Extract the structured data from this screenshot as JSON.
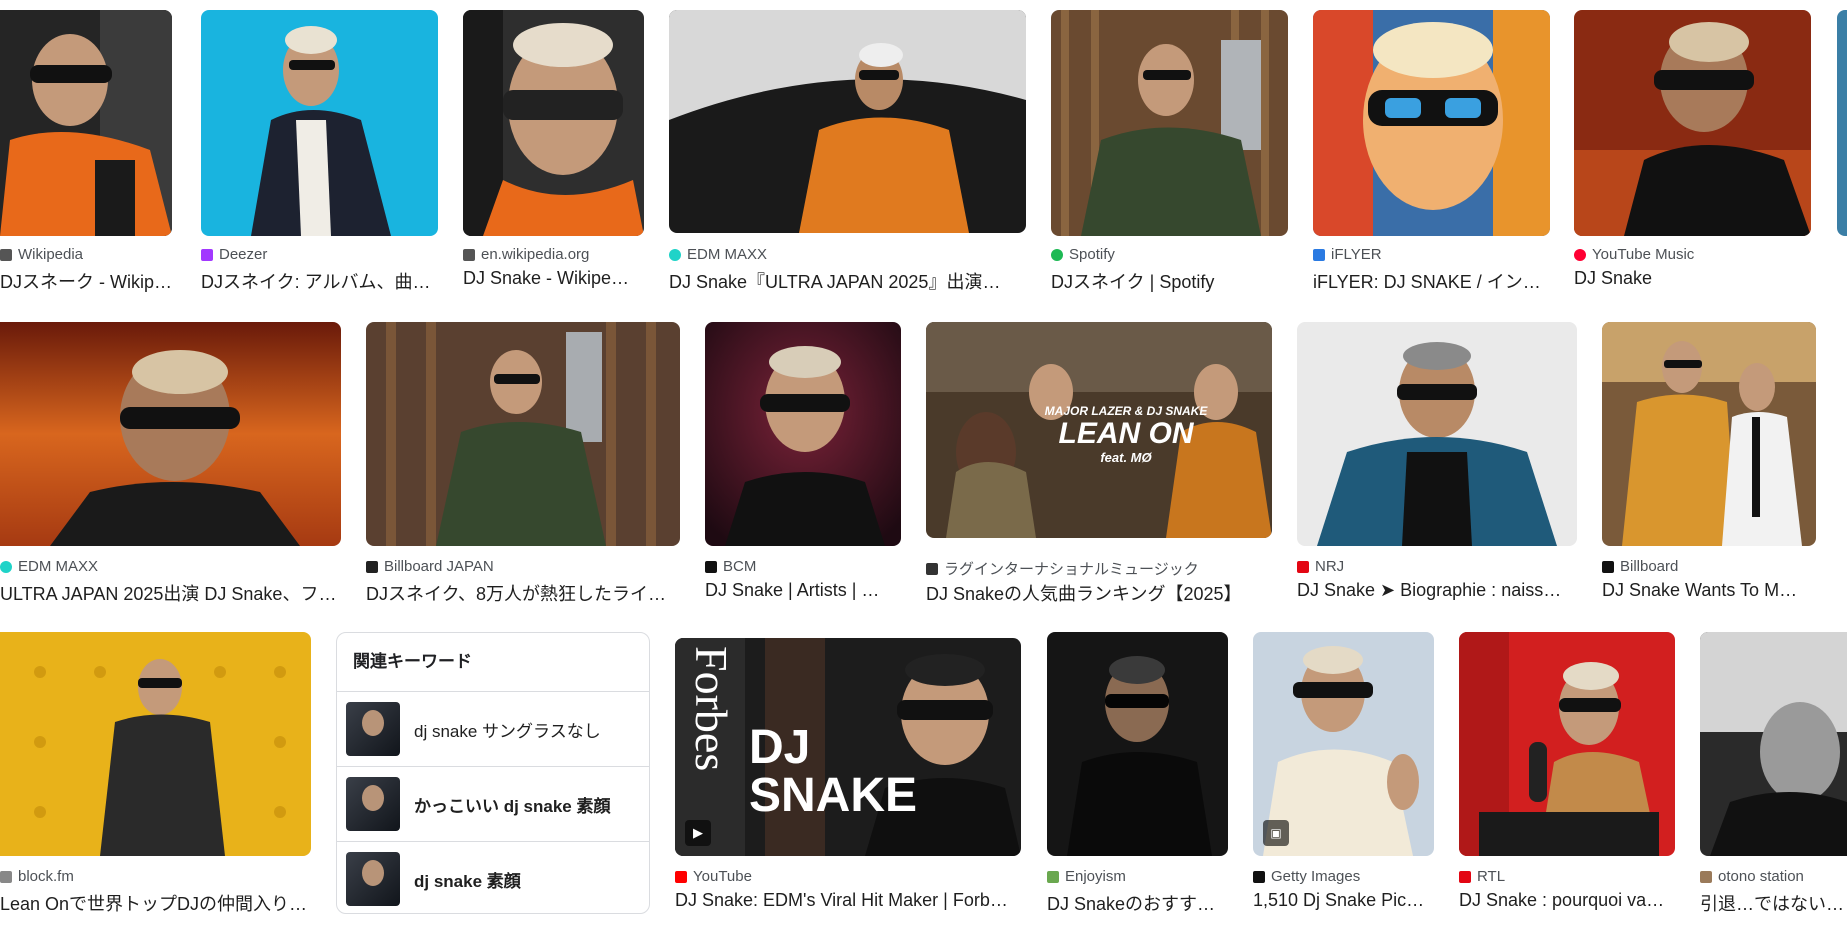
{
  "related": {
    "heading": "関連キーワード",
    "items": [
      {
        "label": "dj snake サングラスなし"
      },
      {
        "label": "かっこいい dj snake 素顔"
      },
      {
        "label": "dj snake 素顔"
      }
    ]
  },
  "results": [
    {
      "source": "Wikipedia",
      "title": "DJスネーク - Wikip…",
      "favicon_color": "#555555",
      "bg": "#2b2b2b"
    },
    {
      "source": "Deezer",
      "title": "DJスネイク: アルバム、曲…",
      "favicon_color": "#a238ff",
      "bg": "#19b4df"
    },
    {
      "source": "en.wikipedia.org",
      "title": "DJ Snake - Wikipe…",
      "favicon_color": "#555555",
      "bg": "#3a3a3a"
    },
    {
      "source": "EDM MAXX",
      "title": "DJ Snake『ULTRA JAPAN 2025』出演…",
      "favicon_color": "#1fd3c8",
      "bg": "#1a1a1a"
    },
    {
      "source": "Spotify",
      "title": "DJスネイク | Spotify",
      "favicon_color": "#1db954",
      "bg": "#6a4a30"
    },
    {
      "source": "iFLYER",
      "title": "iFLYER: DJ SNAKE / イン…",
      "favicon_color": "#2a7ae2",
      "bg": "#d97a2a"
    },
    {
      "source": "YouTube Music",
      "title": "DJ Snake",
      "favicon_color": "#ff0033",
      "bg": "#8a2a12"
    },
    {
      "source": "EDM MAXX",
      "title": "ULTRA JAPAN 2025出演 DJ Snake、フ…",
      "favicon_color": "#1fd3c8",
      "bg": "#b2461a"
    },
    {
      "source": "Billboard JAPAN",
      "title": "DJスネイク、8万人が熱狂したライ…",
      "favicon_color": "#222222",
      "bg": "#5a4030"
    },
    {
      "source": "BCM",
      "title": "DJ Snake | Artists | …",
      "favicon_color": "#111111",
      "bg": "#3a0e1e"
    },
    {
      "source": "ラグインターナショナルミュージック",
      "title": "DJ Snakeの人気曲ランキング【2025】",
      "favicon_color": "#333333",
      "bg": "#5a4430"
    },
    {
      "source": "NRJ",
      "title": "DJ Snake ➤ Biographie : naiss…",
      "favicon_color": "#e30613",
      "bg": "#eaeaea"
    },
    {
      "source": "Billboard",
      "title": "DJ Snake Wants To M…",
      "favicon_color": "#111111",
      "bg": "#7a5a3a"
    },
    {
      "source": "block.fm",
      "title": "Lean Onで世界トップDJの仲間入り…",
      "favicon_color": "#888888",
      "bg": "#e8b21a"
    },
    {
      "source": "YouTube",
      "title": "DJ Snake: EDM's Viral Hit Maker | Forb…",
      "favicon_color": "#ff0000",
      "bg": "#1c1c1c",
      "overlay": {
        "brand": "Forbes",
        "line1": "DJ",
        "line2": "SNAKE"
      }
    },
    {
      "source": "Enjoyism",
      "title": "DJ Snakeのおすす…",
      "favicon_color": "#6aa84f",
      "bg": "#151515"
    },
    {
      "source": "Getty Images",
      "title": "1,510 Dj Snake Pic…",
      "favicon_color": "#111111",
      "bg": "#c8d4e0"
    },
    {
      "source": "RTL",
      "title": "DJ Snake : pourquoi va…",
      "favicon_color": "#e30613",
      "bg": "#d21f1f"
    },
    {
      "source": "otono station",
      "title": "引退…ではない?!…",
      "favicon_color": "#9a7a5a",
      "bg": "#2a2a2a"
    }
  ],
  "overlays": {
    "lean_on_top": "MAJOR LAZER & DJ SNAKE",
    "lean_on_main": "LEAN ON",
    "lean_on_feat": "feat. MØ"
  }
}
